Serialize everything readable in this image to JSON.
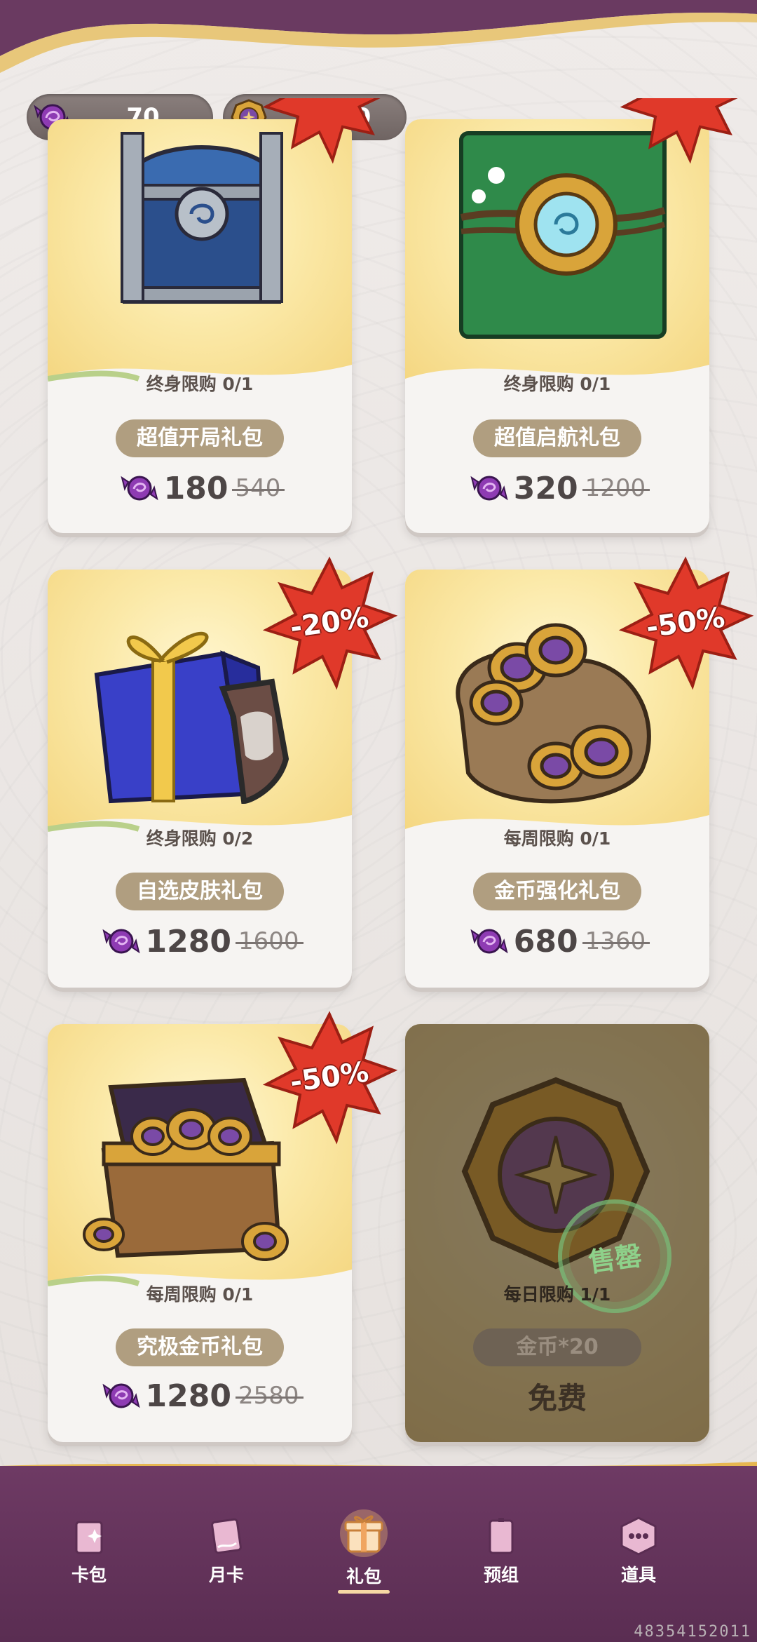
{
  "header": {
    "gems": "70",
    "coins": "9040",
    "gems_icon": "candy-gem-plus-icon",
    "coins_icon": "gold-coin-icon",
    "close_icon": "close-icon"
  },
  "cards": [
    {
      "limit": "终身限购 0/1",
      "name": "超值开局礼包",
      "price": "180",
      "old_price": "540",
      "discount": "",
      "art": "blue-chest"
    },
    {
      "limit": "终身限购 0/1",
      "name": "超值启航礼包",
      "price": "320",
      "old_price": "1200",
      "discount": "",
      "art": "green-book"
    },
    {
      "limit": "终身限购 0/2",
      "name": "自选皮肤礼包",
      "price": "1280",
      "old_price": "1600",
      "discount": "-20%",
      "art": "gift-box-shield"
    },
    {
      "limit": "每周限购 0/1",
      "name": "金币强化礼包",
      "price": "680",
      "old_price": "1360",
      "discount": "-50%",
      "art": "coin-bag"
    },
    {
      "limit": "每周限购 0/1",
      "name": "究极金币礼包",
      "price": "1280",
      "old_price": "2580",
      "discount": "-50%",
      "art": "coin-chest"
    },
    {
      "limit": "每日限购 1/1",
      "name": "金币*20",
      "price": "免费",
      "stamp": "售罄",
      "art": "big-coin"
    }
  ],
  "nav": [
    {
      "label": "卡包",
      "icon": "card-pack-icon"
    },
    {
      "label": "月卡",
      "icon": "monthly-card-icon"
    },
    {
      "label": "礼包",
      "icon": "gift-icon",
      "active": true
    },
    {
      "label": "预组",
      "icon": "preset-deck-icon"
    },
    {
      "label": "道具",
      "icon": "items-icon"
    }
  ],
  "footer_code": "48354152011",
  "colors": {
    "nav_bg": "#5f3057",
    "pill": "#b09e80",
    "burst": "#e0392a",
    "top_band": "#6a3a61"
  }
}
